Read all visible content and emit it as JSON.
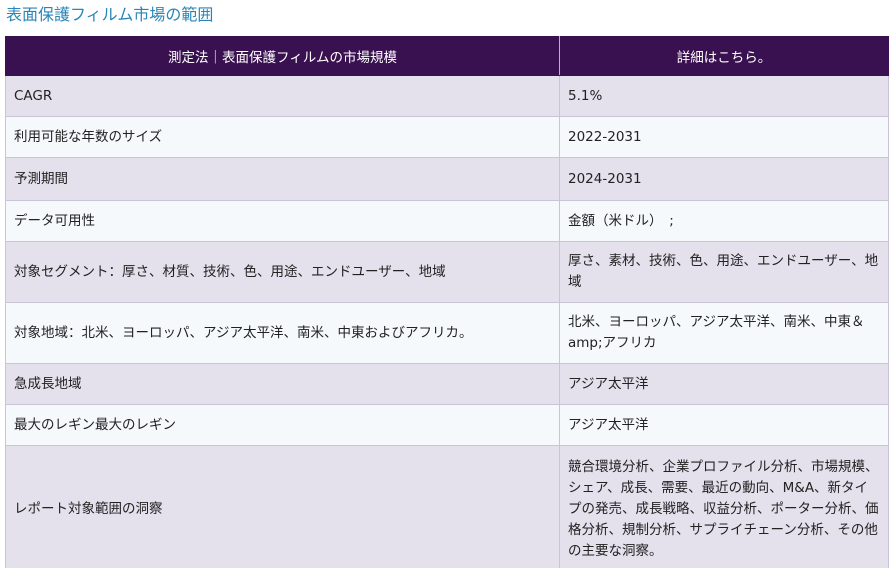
{
  "page_title": "表面保護フィルム市場の範囲",
  "table": {
    "headers": [
      "測定法｜表面保護フィルムの市場規模",
      "詳細はこちら。"
    ],
    "rows": [
      [
        "CAGR",
        "5.1%"
      ],
      [
        "利用可能な年数のサイズ",
        "2022-2031"
      ],
      [
        "予測期間",
        "2024-2031"
      ],
      [
        "データ可用性",
        "金額（米ドル）　;"
      ],
      [
        "対象セグメント：厚さ、材質、技術、色、用途、エンドユーザー、地域",
        "厚さ、素材、技術、色、用途、エンドユーザー、地域"
      ],
      [
        "対象地域：北米、ヨーロッパ、アジア太平洋、南米、中東およびアフリカ。",
        "北米、ヨーロッパ、アジア太平洋、南米、中東＆amp;アフリカ"
      ],
      [
        "急成長地域",
        "アジア太平洋"
      ],
      [
        "最大のレギン最大のレギン",
        "アジア太平洋"
      ],
      [
        "レポート対象範囲の洞察",
        "競合環境分析、企業プロファイル分析、市場規模、シェア、成長、需要、最近の動向、M&A、新タイプの発売、成長戦略、収益分析、ポーター分析、価格分析、規制分析、サプライチェーン分析、その他の主要な洞察。"
      ]
    ]
  }
}
